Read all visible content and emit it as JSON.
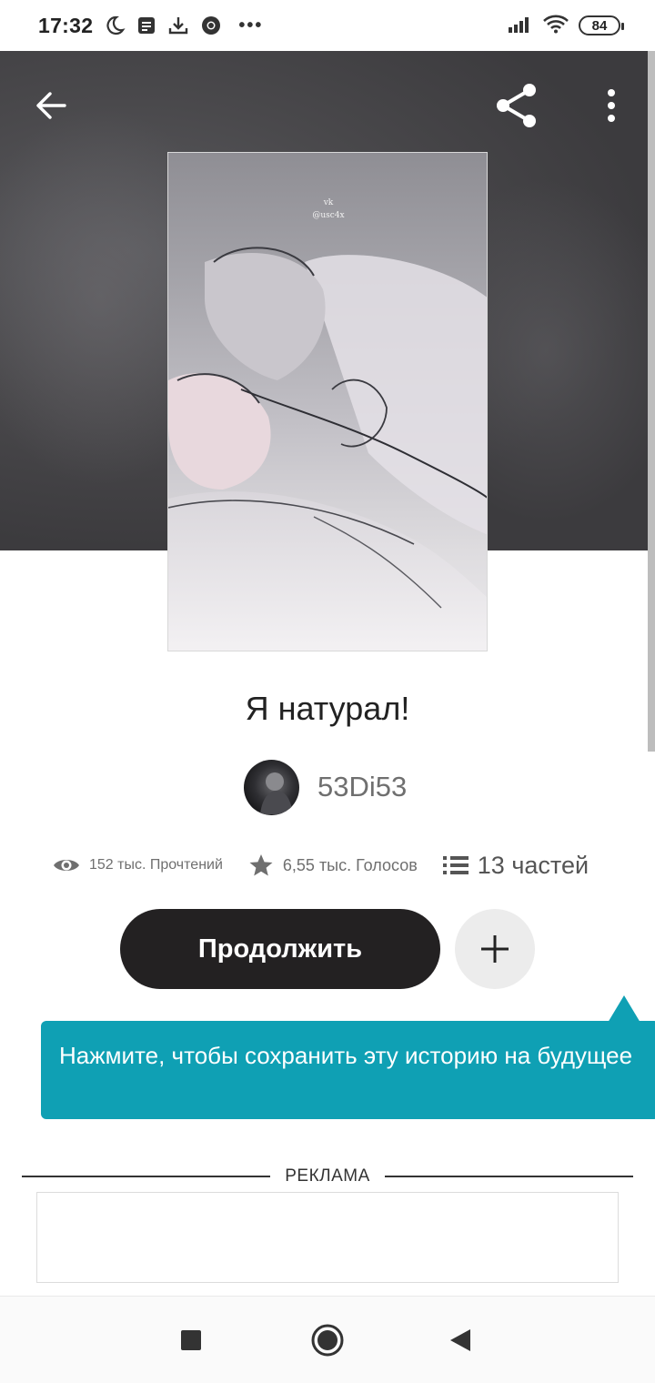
{
  "status_bar": {
    "time": "17:32",
    "battery": "84",
    "icons": [
      "moon-icon",
      "notes-icon",
      "download-icon",
      "chrome-icon",
      "more-dots-icon",
      "signal-icon",
      "wifi-icon",
      "battery-icon"
    ],
    "dots": "•••"
  },
  "header": {
    "icons": [
      "back-arrow-icon",
      "share-icon",
      "more-vertical-icon"
    ]
  },
  "cover": {
    "watermark_line1": "vk",
    "watermark_line2": "@usc4x"
  },
  "story": {
    "title": "Я натурал!",
    "author": "53Di53"
  },
  "stats": {
    "reads": "152 тыс. Прочтений",
    "votes": "6,55 тыс. Голосов",
    "parts": "13 частей"
  },
  "actions": {
    "continue_label": "Продолжить"
  },
  "tooltip": {
    "text": "Нажмите, чтобы сохранить эту историю на будущее"
  },
  "ad": {
    "label": "РЕКЛАМА"
  },
  "colors": {
    "accent": "#0fa0b4",
    "primary_button": "#232122",
    "secondary_button": "#ececec",
    "muted_text": "#6f6f6f"
  }
}
